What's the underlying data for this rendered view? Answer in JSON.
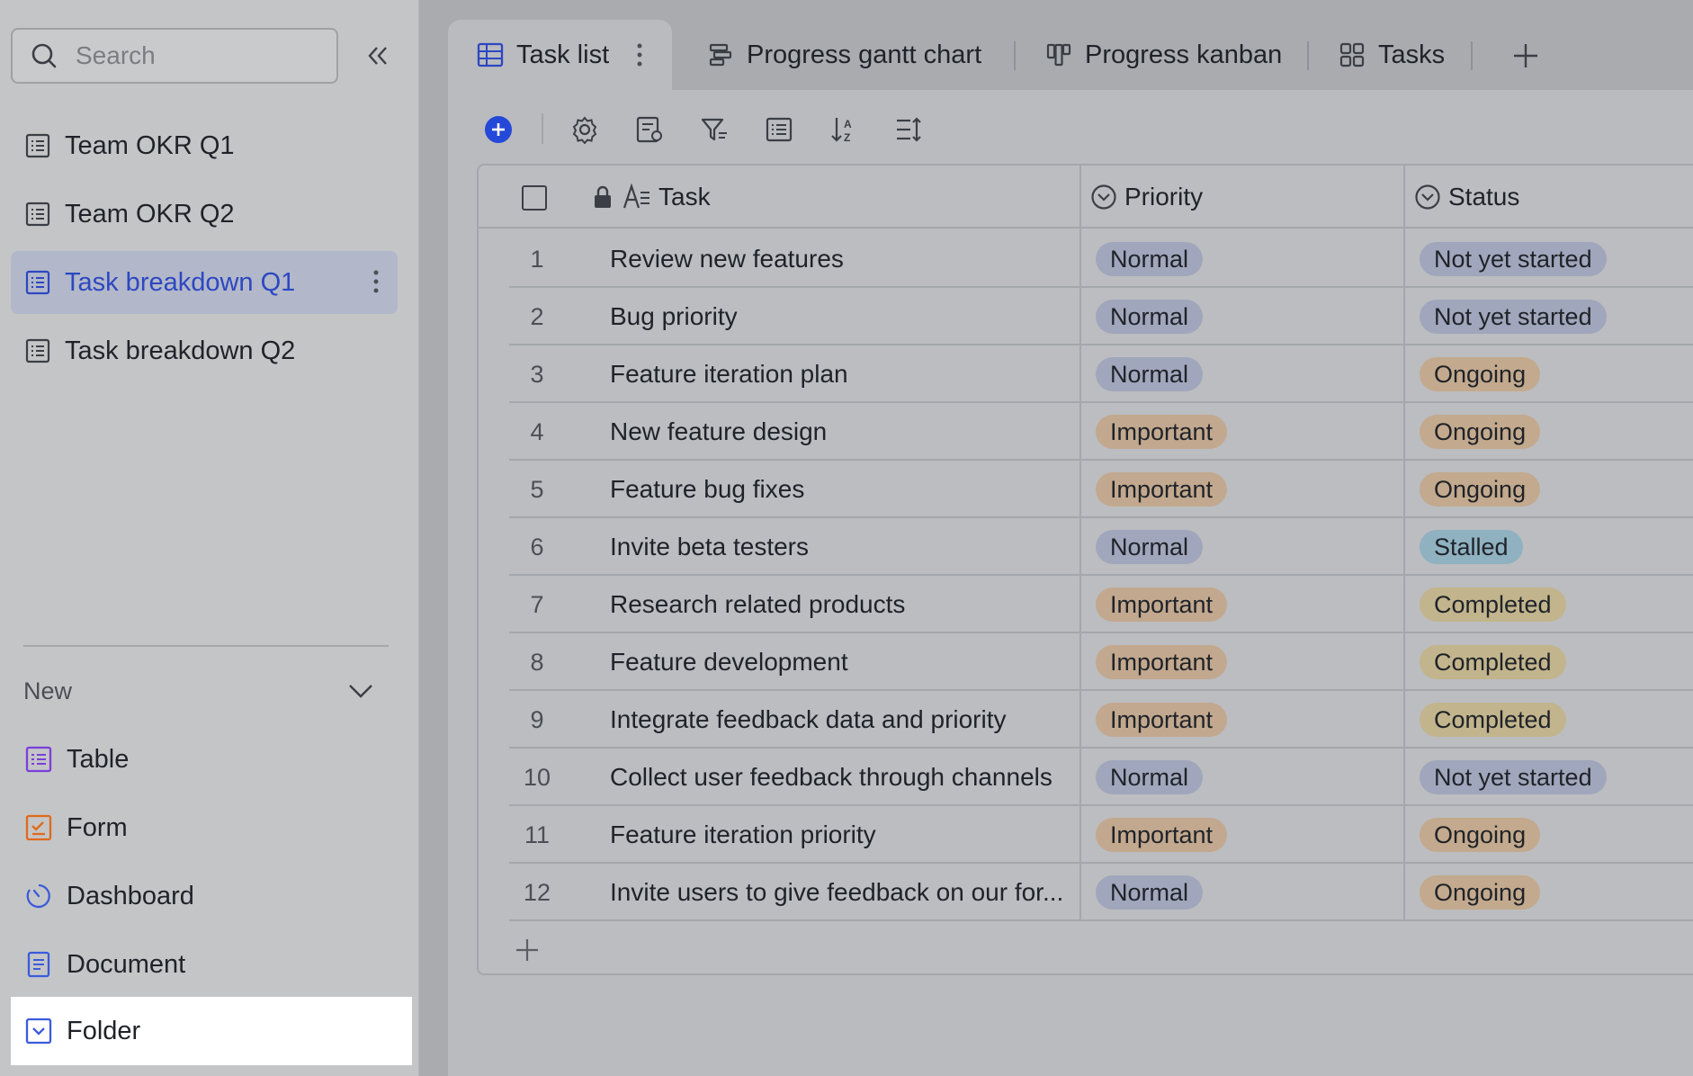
{
  "sidebar": {
    "search_placeholder": "Search",
    "items": [
      {
        "label": "Team OKR Q1"
      },
      {
        "label": "Team OKR Q2"
      },
      {
        "label": "Task breakdown Q1"
      },
      {
        "label": "Task breakdown Q2"
      }
    ],
    "new_section": {
      "label": "New",
      "items": [
        {
          "label": "Table"
        },
        {
          "label": "Form"
        },
        {
          "label": "Dashboard"
        },
        {
          "label": "Document"
        },
        {
          "label": "Folder"
        }
      ]
    }
  },
  "tabs": [
    {
      "label": "Task list"
    },
    {
      "label": "Progress gantt chart"
    },
    {
      "label": "Progress kanban"
    },
    {
      "label": "Tasks"
    }
  ],
  "table": {
    "columns": {
      "task": "Task",
      "priority": "Priority",
      "status": "Status"
    },
    "rows": [
      {
        "num": "1",
        "task": "Review new features",
        "priority": "Normal",
        "status": "Not yet started"
      },
      {
        "num": "2",
        "task": "Bug priority",
        "priority": "Normal",
        "status": "Not yet started"
      },
      {
        "num": "3",
        "task": "Feature iteration plan",
        "priority": "Normal",
        "status": "Ongoing"
      },
      {
        "num": "4",
        "task": "New feature design",
        "priority": "Important",
        "status": "Ongoing"
      },
      {
        "num": "5",
        "task": "Feature bug fixes",
        "priority": "Important",
        "status": "Ongoing"
      },
      {
        "num": "6",
        "task": "Invite beta testers",
        "priority": "Normal",
        "status": "Stalled"
      },
      {
        "num": "7",
        "task": "Research related products",
        "priority": "Important",
        "status": "Completed"
      },
      {
        "num": "8",
        "task": "Feature development",
        "priority": "Important",
        "status": "Completed"
      },
      {
        "num": "9",
        "task": "Integrate feedback data and priority",
        "priority": "Important",
        "status": "Completed"
      },
      {
        "num": "10",
        "task": "Collect user feedback through channels",
        "priority": "Normal",
        "status": "Not yet started"
      },
      {
        "num": "11",
        "task": "Feature iteration priority",
        "priority": "Important",
        "status": "Ongoing"
      },
      {
        "num": "12",
        "task": "Invite users to give feedback on our for...",
        "priority": "Normal",
        "status": "Ongoing"
      }
    ]
  },
  "colors": {
    "accent": "#2d47c2",
    "add_button": "#2448d8",
    "pill_normal": "#a0a6bb",
    "pill_important": "#c2a88e",
    "status_ongoing": "#c3a98d",
    "status_stalled": "#8fb1c0",
    "status_completed": "#c2b48c"
  }
}
